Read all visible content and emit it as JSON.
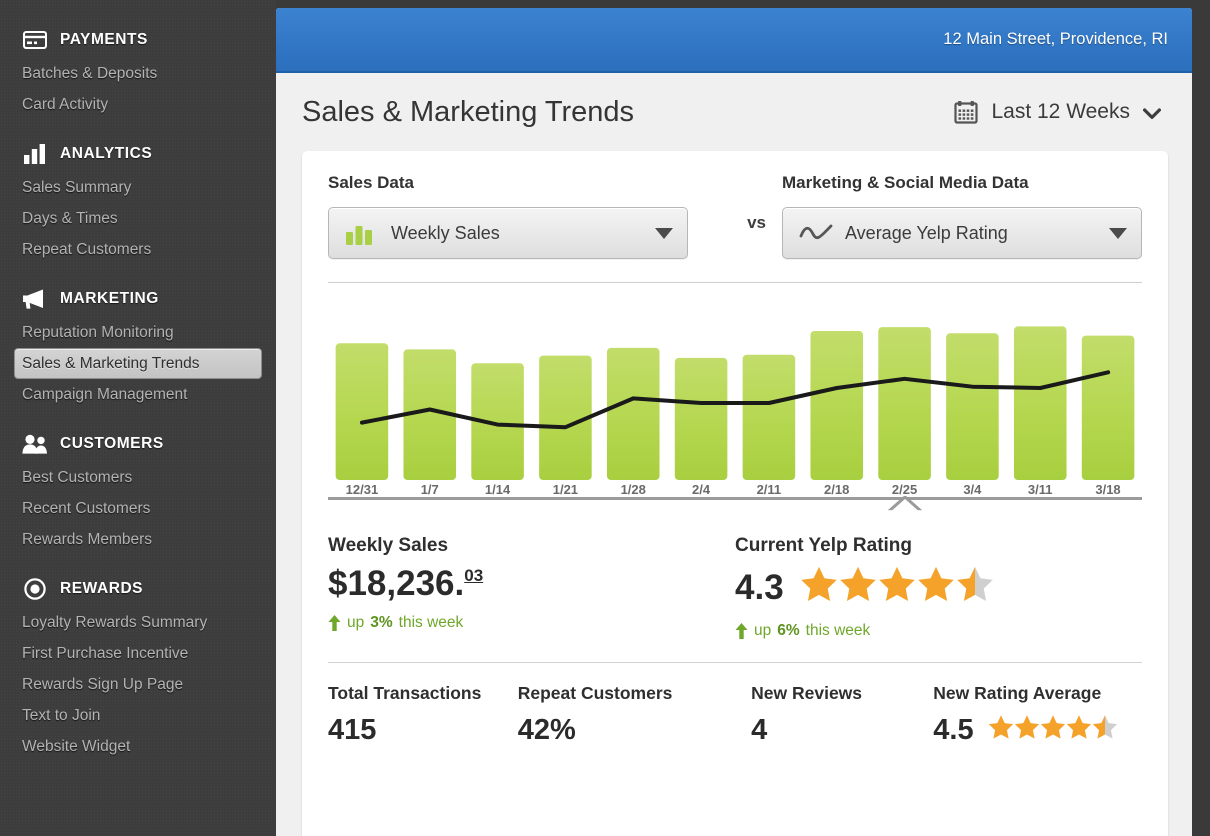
{
  "sidebar": {
    "groups": [
      {
        "title": "PAYMENTS",
        "icon": "credit-card-icon",
        "items": [
          {
            "label": "Batches & Deposits",
            "active": false
          },
          {
            "label": "Card Activity",
            "active": false
          }
        ]
      },
      {
        "title": "ANALYTICS",
        "icon": "bar-chart-icon",
        "items": [
          {
            "label": "Sales Summary",
            "active": false
          },
          {
            "label": "Days & Times",
            "active": false
          },
          {
            "label": "Repeat Customers",
            "active": false
          }
        ]
      },
      {
        "title": "MARKETING",
        "icon": "megaphone-icon",
        "items": [
          {
            "label": "Reputation Monitoring",
            "active": false
          },
          {
            "label": "Sales & Marketing Trends",
            "active": true
          },
          {
            "label": "Campaign Management",
            "active": false
          }
        ]
      },
      {
        "title": "CUSTOMERS",
        "icon": "users-icon",
        "items": [
          {
            "label": "Best Customers",
            "active": false
          },
          {
            "label": "Recent Customers",
            "active": false
          },
          {
            "label": "Rewards Members",
            "active": false
          }
        ]
      },
      {
        "title": "REWARDS",
        "icon": "target-circle-icon",
        "items": [
          {
            "label": "Loyalty Rewards Summary",
            "active": false
          },
          {
            "label": "First Purchase Incentive",
            "active": false
          },
          {
            "label": "Rewards Sign Up Page",
            "active": false
          },
          {
            "label": "Text to Join",
            "active": false
          },
          {
            "label": "Website Widget",
            "active": false
          }
        ]
      }
    ]
  },
  "topbar": {
    "address": "12 Main Street, Providence, RI",
    "accent_color": "#3b82d0"
  },
  "page": {
    "title": "Sales & Marketing Trends",
    "date_range_label": "Last 12 Weeks"
  },
  "selectors": {
    "left": {
      "label": "Sales Data",
      "value": "Weekly Sales",
      "icon": "bar-chart-icon"
    },
    "vs": "vs",
    "right": {
      "label": "Marketing & Social Media Data",
      "value": "Average Yelp Rating",
      "icon": "line-chart-icon"
    }
  },
  "chart_data": {
    "type": "bar",
    "title": "",
    "xlabel": "",
    "ylabel": "",
    "grid": false,
    "legend": false,
    "categories": [
      "12/31",
      "1/7",
      "1/14",
      "1/21",
      "1/28",
      "2/4",
      "2/11",
      "2/18",
      "2/25",
      "3/4",
      "3/11",
      "3/18"
    ],
    "series": [
      {
        "name": "Weekly Sales",
        "type": "bar",
        "color": "#b0d54a",
        "values": [
          17800,
          17000,
          15200,
          16200,
          17200,
          15900,
          16300,
          19400,
          19900,
          19100,
          20000,
          18800
        ]
      },
      {
        "name": "Average Yelp Rating",
        "type": "line",
        "color": "#1a1a1a",
        "values": [
          3.85,
          4.05,
          3.82,
          3.78,
          4.22,
          4.15,
          4.15,
          4.38,
          4.52,
          4.4,
          4.38,
          4.62
        ]
      }
    ],
    "ylim_bars": [
      0,
      22000
    ],
    "ylim_line": [
      3.4,
      4.9
    ],
    "marker_category": "2/25"
  },
  "stats": {
    "primary": [
      {
        "title": "Weekly Sales",
        "value": "$18,236.",
        "cents": "03",
        "trend_prefix": "up",
        "trend_value": "3%",
        "trend_suffix": "this week",
        "trend_color": "#6fa72b"
      },
      {
        "title": "Current Yelp Rating",
        "value": "4.3",
        "stars": 4.5,
        "trend_prefix": "up",
        "trend_value": "6%",
        "trend_suffix": "this week",
        "trend_color": "#6fa72b"
      }
    ],
    "secondary": [
      {
        "title": "Total Transactions",
        "value": "415",
        "stars": null
      },
      {
        "title": "Repeat Customers",
        "value": "42%",
        "stars": null
      },
      {
        "title": "New Reviews",
        "value": "4",
        "stars": null
      },
      {
        "title": "New Rating Average",
        "value": "4.5",
        "stars": 4.5
      }
    ]
  },
  "colors": {
    "bar_green": "#b0d54a",
    "star_orange": "#f5a22a",
    "star_grey": "#cfcfcf",
    "blue": "#3b82d0",
    "sidebar": "#3d3d3d"
  }
}
